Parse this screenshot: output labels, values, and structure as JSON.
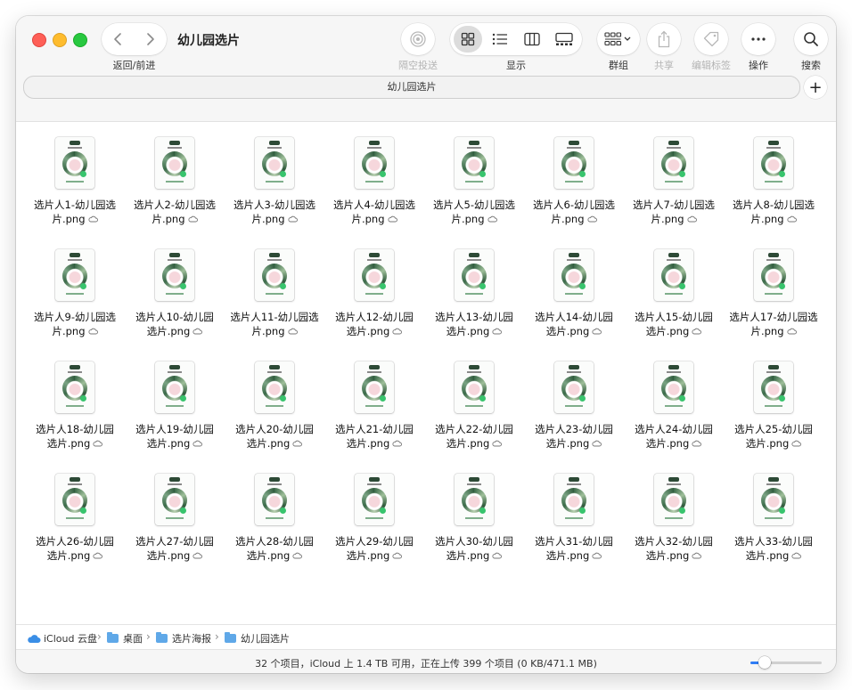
{
  "window": {
    "title": "幼儿园选片"
  },
  "toolbar": {
    "nav_label": "返回/前进",
    "airdrop_label": "隔空投送",
    "view_label": "显示",
    "group_label": "群组",
    "share_label": "共享",
    "tags_label": "编辑标签",
    "action_label": "操作",
    "search_label": "搜索"
  },
  "tabbar": {
    "tab_title": "幼儿园选片",
    "add_tab": "+"
  },
  "files": [
    {
      "line1": "选片人1-幼儿园选",
      "line2": "片.png"
    },
    {
      "line1": "选片人2-幼儿园选",
      "line2": "片.png"
    },
    {
      "line1": "选片人3-幼儿园选",
      "line2": "片.png"
    },
    {
      "line1": "选片人4-幼儿园选",
      "line2": "片.png"
    },
    {
      "line1": "选片人5-幼儿园选",
      "line2": "片.png"
    },
    {
      "line1": "选片人6-幼儿园选",
      "line2": "片.png"
    },
    {
      "line1": "选片人7-幼儿园选",
      "line2": "片.png"
    },
    {
      "line1": "选片人8-幼儿园选",
      "line2": "片.png"
    },
    {
      "line1": "选片人9-幼儿园选",
      "line2": "片.png"
    },
    {
      "line1": "选片人10-幼儿园",
      "line2": "选片.png"
    },
    {
      "line1": "选片人11-幼儿园选",
      "line2": "片.png"
    },
    {
      "line1": "选片人12-幼儿园",
      "line2": "选片.png"
    },
    {
      "line1": "选片人13-幼儿园",
      "line2": "选片.png"
    },
    {
      "line1": "选片人14-幼儿园",
      "line2": "选片.png"
    },
    {
      "line1": "选片人15-幼儿园",
      "line2": "选片.png"
    },
    {
      "line1": "选片人17-幼儿园选",
      "line2": "片.png"
    },
    {
      "line1": "选片人18-幼儿园",
      "line2": "选片.png"
    },
    {
      "line1": "选片人19-幼儿园",
      "line2": "选片.png"
    },
    {
      "line1": "选片人20-幼儿园",
      "line2": "选片.png"
    },
    {
      "line1": "选片人21-幼儿园",
      "line2": "选片.png"
    },
    {
      "line1": "选片人22-幼儿园",
      "line2": "选片.png"
    },
    {
      "line1": "选片人23-幼儿园",
      "line2": "选片.png"
    },
    {
      "line1": "选片人24-幼儿园",
      "line2": "选片.png"
    },
    {
      "line1": "选片人25-幼儿园",
      "line2": "选片.png"
    },
    {
      "line1": "选片人26-幼儿园",
      "line2": "选片.png"
    },
    {
      "line1": "选片人27-幼儿园",
      "line2": "选片.png"
    },
    {
      "line1": "选片人28-幼儿园",
      "line2": "选片.png"
    },
    {
      "line1": "选片人29-幼儿园",
      "line2": "选片.png"
    },
    {
      "line1": "选片人30-幼儿园",
      "line2": "选片.png"
    },
    {
      "line1": "选片人31-幼儿园",
      "line2": "选片.png"
    },
    {
      "line1": "选片人32-幼儿园",
      "line2": "选片.png"
    },
    {
      "line1": "选片人33-幼儿园",
      "line2": "选片.png"
    }
  ],
  "pathbar": {
    "items": [
      "iCloud 云盘",
      "桌面",
      "选片海报",
      "幼儿园选片"
    ]
  },
  "statusbar": {
    "text": "32 个项目，iCloud 上 1.4 TB 可用，正在上传 399 个项目 (0 KB/471.1 MB)",
    "zoom_level": 0.2
  },
  "icons": {
    "cloud": "icloud-upload-icon",
    "accent": "#2f7df6"
  }
}
